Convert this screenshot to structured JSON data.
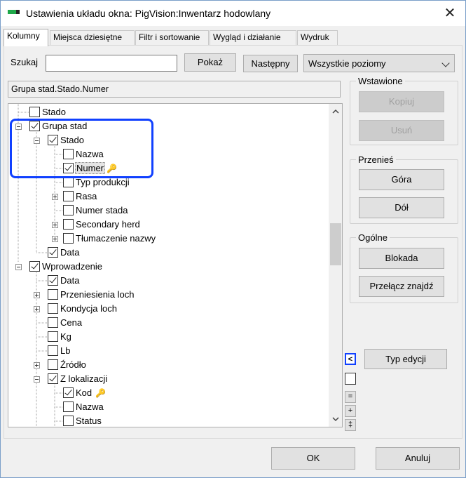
{
  "window": {
    "title": "Ustawienia układu okna: PigVision:Inwentarz hodowlany",
    "close_glyph": "✕"
  },
  "tabs": [
    {
      "label": "Kolumny",
      "active": true
    },
    {
      "label": "Miejsca dziesiętne"
    },
    {
      "label": "Filtr i sortowanie"
    },
    {
      "label": "Wygląd i działanie"
    },
    {
      "label": "Wydruk"
    }
  ],
  "search": {
    "label": "Szukaj",
    "value": "",
    "show_button": "Pokaż",
    "next_button": "Następny",
    "level_select": "Wszystkie poziomy"
  },
  "path": "Grupa stad.Stado.Numer",
  "tree": [
    {
      "label": "Stado",
      "checked": false
    },
    {
      "label": "Grupa stad",
      "checked": true,
      "expander": "minus"
    },
    {
      "label": "Stado",
      "checked": true,
      "expander": "minus"
    },
    {
      "label": "Nazwa",
      "checked": false
    },
    {
      "label": "Numer",
      "checked": true,
      "selected": true,
      "key": true
    },
    {
      "label": "Typ produkcji",
      "checked": false
    },
    {
      "label": "Rasa",
      "checked": false,
      "expander": "plus"
    },
    {
      "label": "Numer stada",
      "checked": false
    },
    {
      "label": "Secondary herd",
      "checked": false,
      "expander": "plus"
    },
    {
      "label": "Tłumaczenie nazwy",
      "checked": false,
      "expander": "plus"
    },
    {
      "label": "Data",
      "checked": true
    },
    {
      "label": "Wprowadzenie",
      "checked": true,
      "expander": "minus"
    },
    {
      "label": "Data",
      "checked": true
    },
    {
      "label": "Przeniesienia loch",
      "checked": false,
      "expander": "plus"
    },
    {
      "label": "Kondycja loch",
      "checked": false,
      "expander": "plus"
    },
    {
      "label": "Cena",
      "checked": false
    },
    {
      "label": "Kg",
      "checked": false
    },
    {
      "label": "Lb",
      "checked": false
    },
    {
      "label": "Źródło",
      "checked": false,
      "expander": "plus"
    },
    {
      "label": "Z lokalizacji",
      "checked": true,
      "expander": "minus"
    },
    {
      "label": "Kod",
      "checked": true,
      "key": true
    },
    {
      "label": "Nazwa",
      "checked": false
    },
    {
      "label": "Status",
      "checked": false
    }
  ],
  "groups": {
    "inserted": {
      "title": "Wstawione",
      "copy": "Kopiuj",
      "remove": "Usuń"
    },
    "move": {
      "title": "Przenieś",
      "up": "Góra",
      "down": "Dół"
    },
    "general": {
      "title": "Ogólne",
      "lock": "Blokada",
      "toggle_found": "Przełącz znajdź"
    }
  },
  "edit_type_button": "Typ edycji",
  "side_buttons": {
    "back": "<",
    "equal": "=",
    "plus": "+",
    "plusminus": "‡"
  },
  "footer": {
    "ok": "OK",
    "cancel": "Anuluj"
  }
}
